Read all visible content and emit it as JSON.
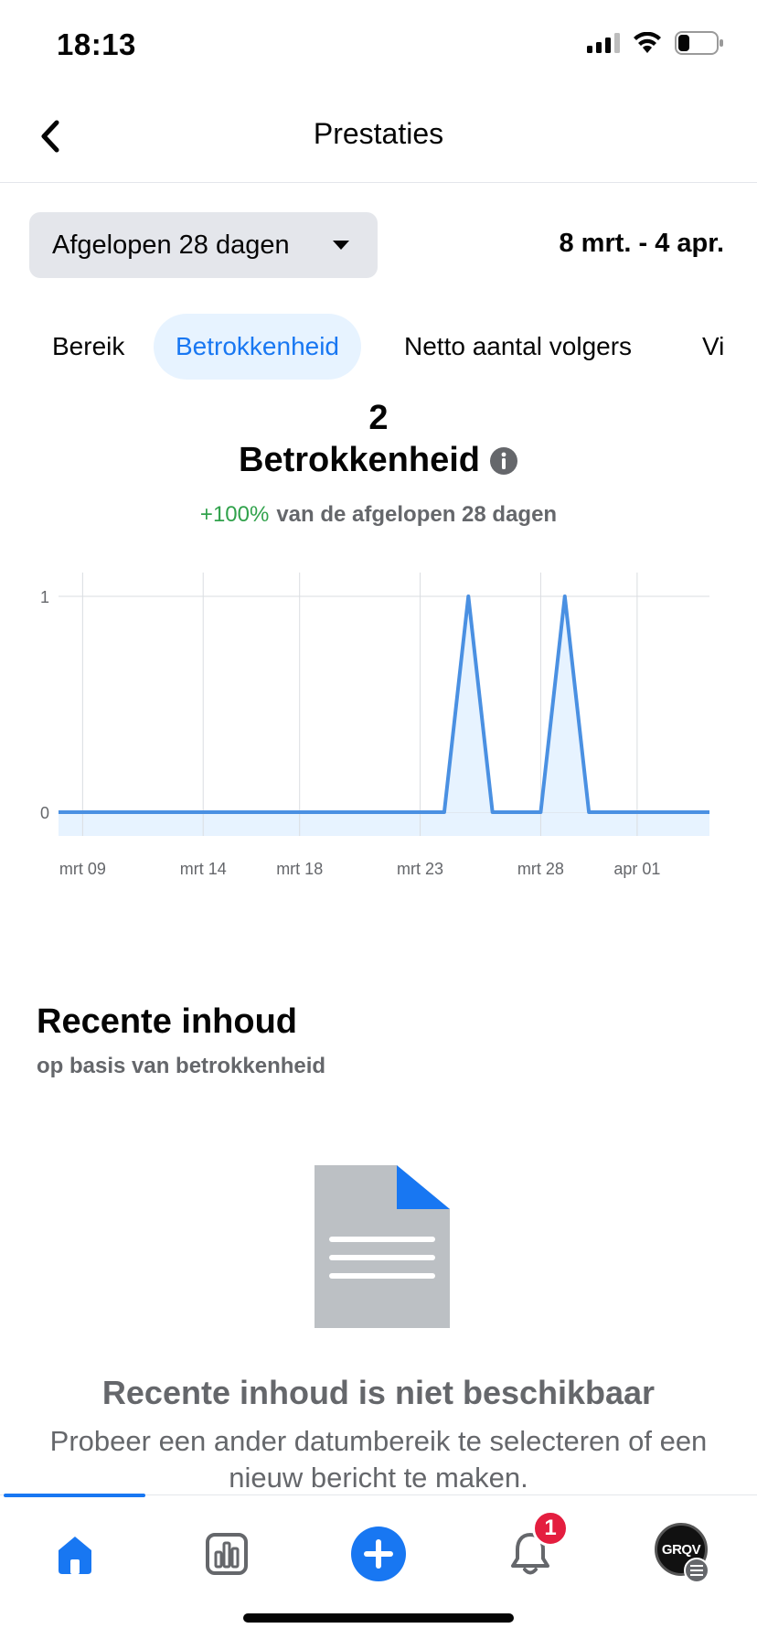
{
  "status_bar": {
    "time": "18:13",
    "battery_level": 0.3
  },
  "header": {
    "title": "Prestaties"
  },
  "filters": {
    "range_label": "Afgelopen 28 dagen",
    "date_range": "8 mrt. - 4 apr."
  },
  "tabs": [
    {
      "label": "Bereik",
      "active": false
    },
    {
      "label": "Betrokkenheid",
      "active": true
    },
    {
      "label": "Netto aantal volgers",
      "active": false
    },
    {
      "label": "Vi",
      "active": false
    }
  ],
  "metric": {
    "value": "2",
    "label": "Betrokkenheid",
    "change": "+100%",
    "change_text": "van de afgelopen 28 dagen"
  },
  "chart_data": {
    "type": "area",
    "x": [
      "mrt 08",
      "mrt 09",
      "mrt 10",
      "mrt 11",
      "mrt 12",
      "mrt 13",
      "mrt 14",
      "mrt 15",
      "mrt 16",
      "mrt 17",
      "mrt 18",
      "mrt 19",
      "mrt 20",
      "mrt 21",
      "mrt 22",
      "mrt 23",
      "mrt 24",
      "mrt 25",
      "mrt 26",
      "mrt 27",
      "mrt 28",
      "mrt 29",
      "mrt 30",
      "mrt 31",
      "apr 01",
      "apr 02",
      "apr 03",
      "apr 04"
    ],
    "values": [
      0,
      0,
      0,
      0,
      0,
      0,
      0,
      0,
      0,
      0,
      0,
      0,
      0,
      0,
      0,
      0,
      0,
      1,
      0,
      0,
      0,
      1,
      0,
      0,
      0,
      0,
      0,
      0
    ],
    "x_ticks": [
      "mrt 09",
      "mrt 14",
      "mrt 18",
      "mrt 23",
      "mrt 28",
      "apr 01"
    ],
    "y_ticks": [
      "0",
      "1"
    ],
    "ylim": [
      0,
      1
    ],
    "grid": true,
    "color": "#4a90e2",
    "fill": "#e7f3ff"
  },
  "recent": {
    "title": "Recente inhoud",
    "subtitle": "op basis van betrokkenheid",
    "empty_title": "Recente inhoud is niet beschikbaar",
    "empty_desc": "Probeer een ander datumbereik te selecteren of een nieuw bericht te maken."
  },
  "bottom_nav": {
    "items": [
      "home-icon",
      "insights-icon",
      "create-icon",
      "notifications-icon",
      "profile-avatar"
    ],
    "notification_count": "1",
    "avatar_text": "GRQV"
  },
  "colors": {
    "accent": "#1877f2",
    "positive": "#31a24c",
    "badge": "#e41e3f"
  }
}
